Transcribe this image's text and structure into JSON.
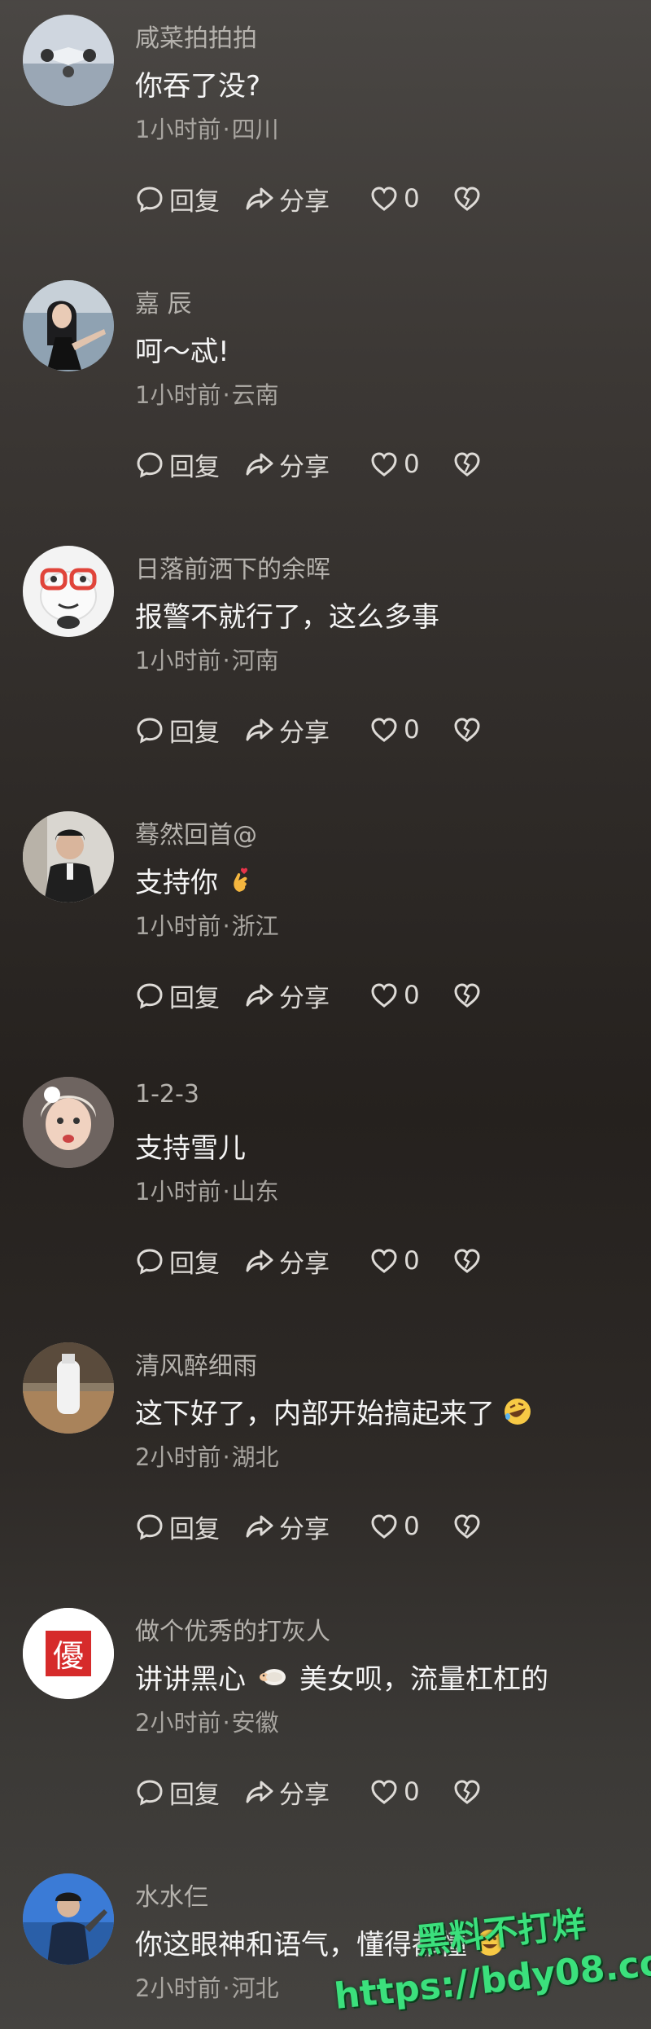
{
  "comments": [
    {
      "username": "咸菜拍拍拍",
      "content": "你吞了没?",
      "time": "1小时前",
      "location": "四川",
      "likes": "0",
      "emoji": ""
    },
    {
      "username": "嘉 辰",
      "content": "呵～忒!",
      "time": "1小时前",
      "location": "云南",
      "likes": "0",
      "emoji": ""
    },
    {
      "username": "日落前洒下的余晖",
      "content": "报警不就行了，这么多事",
      "time": "1小时前",
      "location": "河南",
      "likes": "0",
      "emoji": ""
    },
    {
      "username": "蓦然回首@",
      "content": "支持你",
      "time": "1小时前",
      "location": "浙江",
      "likes": "0",
      "emoji": "finger-heart"
    },
    {
      "username": "1-2-3",
      "content": "支持雪儿",
      "time": "1小时前",
      "location": "山东",
      "likes": "0",
      "emoji": ""
    },
    {
      "username": "清风醉细雨",
      "content": "这下好了，内部开始搞起来了",
      "time": "2小时前",
      "location": "湖北",
      "likes": "0",
      "emoji": "rofl"
    },
    {
      "username": "做个优秀的打灰人",
      "content_a": "讲讲黑心",
      "content_b": "美女呗，流量杠杠的",
      "time": "2小时前",
      "location": "安徽",
      "likes": "0",
      "emoji": "lamb"
    },
    {
      "username": "水水仨",
      "content": "你这眼神和语气，懂得都懂",
      "time": "2小时前",
      "location": "河北",
      "likes": "0",
      "emoji": "grin"
    }
  ],
  "actions": {
    "reply": "回复",
    "share": "分享"
  },
  "dot": "·",
  "avatar7_char": "優",
  "watermark": {
    "line1": "黑料不打烊",
    "line2": "https://bdy08.co"
  },
  "colors": {
    "accent": "#3be07c",
    "background": "#2f2b28"
  }
}
